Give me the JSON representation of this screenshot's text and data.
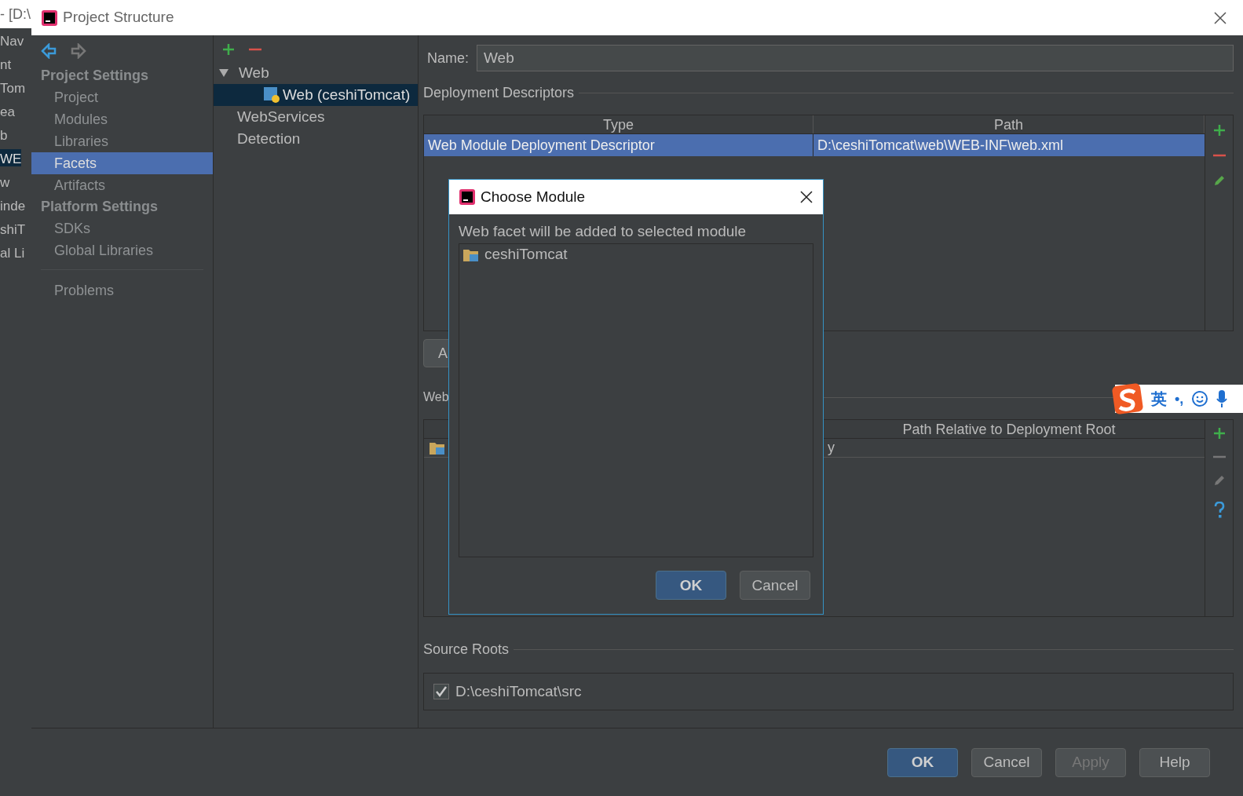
{
  "background_window": {
    "title": "- [D:\\",
    "items": [
      {
        "label": "Nav",
        "selected": false
      },
      {
        "label": "nt",
        "selected": false
      },
      {
        "label": "Tom",
        "selected": false
      },
      {
        "label": "ea",
        "selected": false
      },
      {
        "label": "b",
        "selected": false
      },
      {
        "label": "WE",
        "selected": true
      },
      {
        "label": "w",
        "selected": false
      },
      {
        "label": "inde",
        "selected": false
      },
      {
        "label": "shiT",
        "selected": false
      },
      {
        "label": "al Li",
        "selected": false
      }
    ]
  },
  "window": {
    "title": "Project Structure"
  },
  "sidebar": {
    "sections": [
      {
        "title": "Project Settings",
        "items": [
          {
            "label": "Project",
            "selected": false
          },
          {
            "label": "Modules",
            "selected": false
          },
          {
            "label": "Libraries",
            "selected": false
          },
          {
            "label": "Facets",
            "selected": true
          },
          {
            "label": "Artifacts",
            "selected": false
          }
        ]
      },
      {
        "title": "Platform Settings",
        "items": [
          {
            "label": "SDKs",
            "selected": false
          },
          {
            "label": "Global Libraries",
            "selected": false
          }
        ]
      }
    ],
    "footer_item": {
      "label": "Problems",
      "selected": false
    }
  },
  "facet_tree": {
    "items": [
      {
        "label": "Web",
        "expanded": true,
        "selected": false,
        "children": [
          {
            "label": "Web (ceshiTomcat)",
            "selected": true
          }
        ]
      },
      {
        "label": "WebServices",
        "selected": false
      },
      {
        "label": "Detection",
        "selected": false
      }
    ]
  },
  "name_field": {
    "label": "Name:",
    "value": "Web"
  },
  "deployment_descriptors": {
    "title": "Deployment Descriptors",
    "columns": [
      "Type",
      "Path"
    ],
    "rows": [
      {
        "cells": [
          "Web Module Deployment Descriptor",
          "D:\\ceshiTomcat\\web\\WEB-INF\\web.xml"
        ],
        "selected": true
      }
    ],
    "button_fragment": "A"
  },
  "web_resource_directories": {
    "title_fragment": "Web",
    "columns": [
      "Path Relative to Deployment Root"
    ],
    "rows": [
      {
        "cell_fragment": "y"
      }
    ]
  },
  "source_roots": {
    "title": "Source Roots",
    "items": [
      {
        "label": "D:\\ceshiTomcat\\src",
        "checked": true
      }
    ]
  },
  "buttons": [
    {
      "label": "OK",
      "kind": "primary",
      "disabled": false
    },
    {
      "label": "Cancel",
      "kind": "normal",
      "disabled": false
    },
    {
      "label": "Apply",
      "kind": "normal",
      "disabled": true
    },
    {
      "label": "Help",
      "kind": "normal",
      "disabled": false
    }
  ],
  "dialog": {
    "title": "Choose Module",
    "message": "Web facet will be added to selected module",
    "modules": [
      {
        "label": "ceshiTomcat",
        "selected": false
      }
    ],
    "buttons": [
      {
        "label": "OK",
        "kind": "primary"
      },
      {
        "label": "Cancel",
        "kind": "normal"
      }
    ]
  },
  "ime_toolbar": {
    "mode": "英",
    "punctuation": "•,"
  }
}
